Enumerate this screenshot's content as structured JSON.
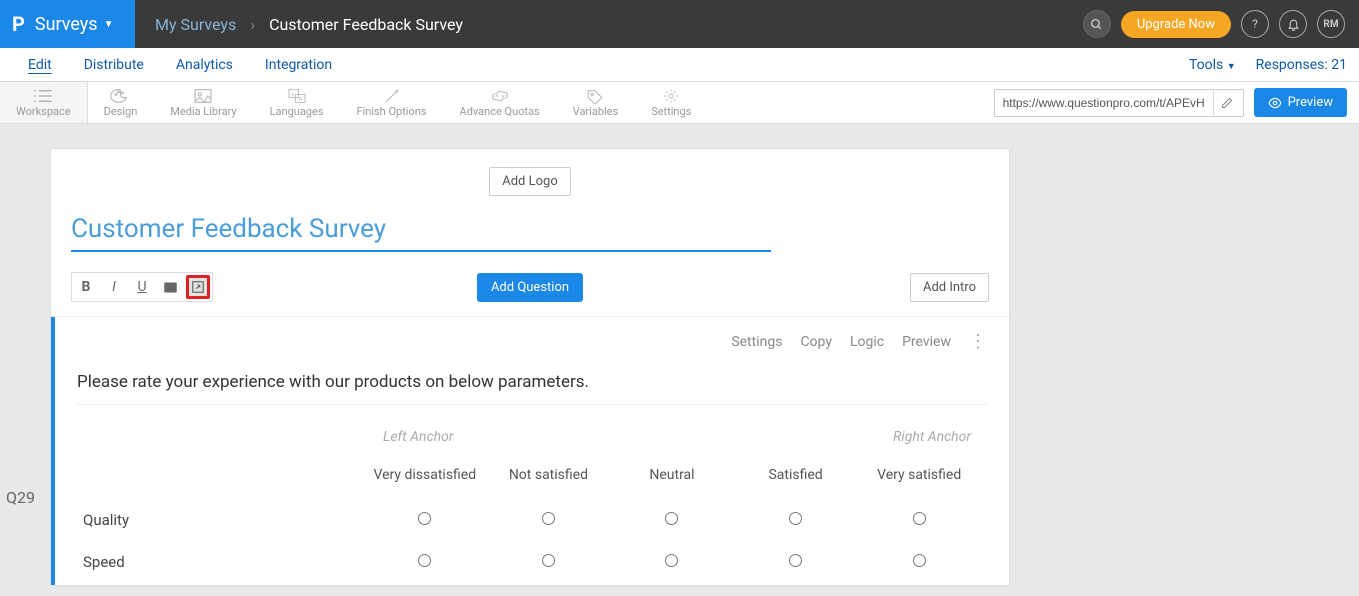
{
  "brand": {
    "product": "Surveys"
  },
  "breadcrumb": {
    "root": "My Surveys",
    "current": "Customer Feedback Survey"
  },
  "header": {
    "upgrade": "Upgrade Now",
    "user_initials": "RM"
  },
  "tabs": {
    "items": [
      "Edit",
      "Distribute",
      "Analytics",
      "Integration"
    ],
    "tools": "Tools",
    "responses_label": "Responses:",
    "responses_count": "21"
  },
  "toolbar": {
    "items": [
      "Workspace",
      "Design",
      "Media Library",
      "Languages",
      "Finish Options",
      "Advance Quotas",
      "Variables",
      "Settings"
    ],
    "url": "https://www.questionpro.com/t/APEvHZeq",
    "preview": "Preview"
  },
  "survey": {
    "add_logo": "Add Logo",
    "title": "Customer Feedback Survey",
    "add_question": "Add Question",
    "add_intro": "Add Intro"
  },
  "question": {
    "number": "Q29",
    "actions": [
      "Settings",
      "Copy",
      "Logic",
      "Preview"
    ],
    "text": "Please rate your experience with our products on below parameters.",
    "anchor_left": "Left Anchor",
    "anchor_right": "Right Anchor",
    "columns": [
      "Very dissatisfied",
      "Not satisfied",
      "Neutral",
      "Satisfied",
      "Very satisfied"
    ],
    "rows": [
      "Quality",
      "Speed"
    ]
  }
}
